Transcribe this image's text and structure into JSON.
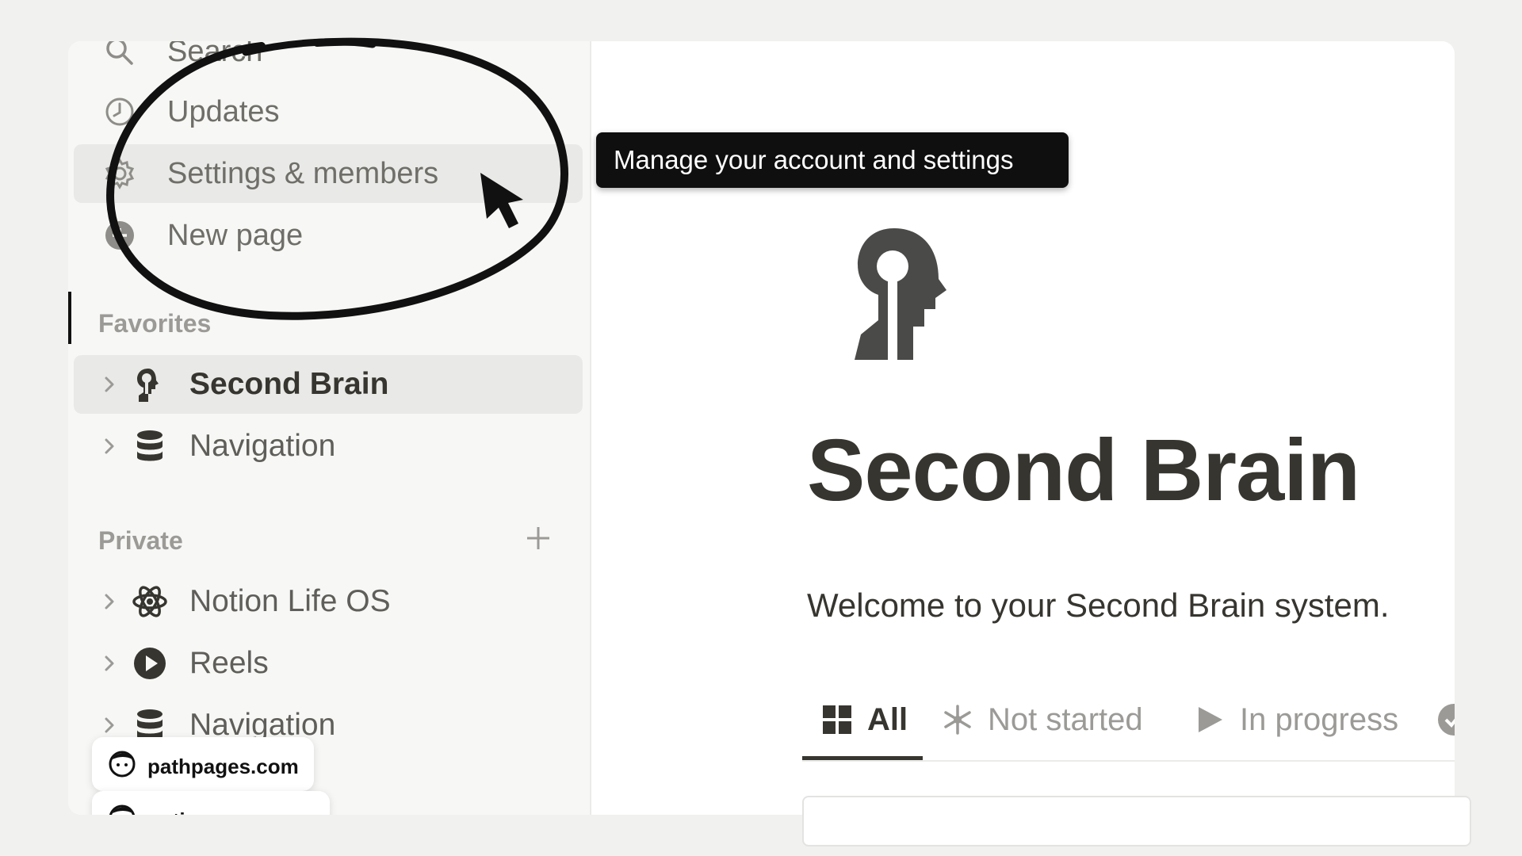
{
  "sidebar": {
    "top_items": [
      {
        "label": "Search",
        "icon": "search-icon"
      },
      {
        "label": "Updates",
        "icon": "clock-icon"
      },
      {
        "label": "Settings & members",
        "icon": "gear-icon"
      },
      {
        "label": "New page",
        "icon": "plus-circle-icon"
      }
    ],
    "favorites": {
      "heading": "Favorites",
      "items": [
        {
          "label": "Second Brain",
          "icon": "brain-head-icon"
        },
        {
          "label": "Navigation",
          "icon": "database-icon"
        }
      ]
    },
    "private": {
      "heading": "Private",
      "add_symbol": "+",
      "items": [
        {
          "label": "Notion Life OS",
          "icon": "atom-icon"
        },
        {
          "label": "Reels",
          "icon": "play-circle-icon"
        },
        {
          "label": "Navigation",
          "icon": "database-icon"
        }
      ]
    }
  },
  "tooltip": {
    "text": "Manage your account and settings"
  },
  "page": {
    "icon": "brain-head-icon",
    "title": "Second Brain",
    "description": "Welcome to your Second Brain system."
  },
  "tabs": [
    {
      "label": "All",
      "icon": "grid-icon",
      "active": true
    },
    {
      "label": "Not started",
      "icon": "snowflake-icon",
      "active": false
    },
    {
      "label": "In progress",
      "icon": "play-icon",
      "active": false
    }
  ],
  "watermarks": [
    {
      "text": "pathpages.com",
      "icon": "avatar-icon"
    },
    {
      "text": "notionway.com",
      "icon": "avatar-icon"
    }
  ],
  "colors": {
    "sidebar_bg": "#f7f7f5",
    "active_row": "#e9e9e7",
    "tooltip_bg": "#0f0f0f",
    "text_primary": "#37352f",
    "text_muted": "#9b9a97"
  }
}
